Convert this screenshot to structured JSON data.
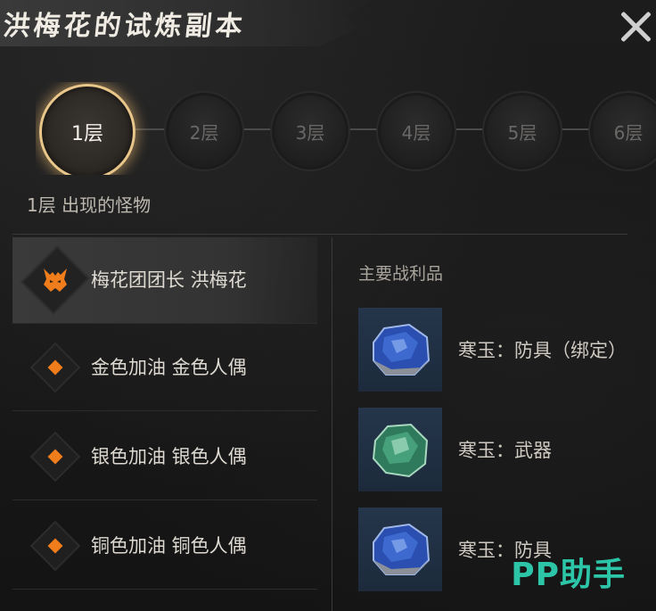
{
  "title": "洪梅花的试炼副本",
  "floors": [
    "1层",
    "2层",
    "3层",
    "4层",
    "5层",
    "6层"
  ],
  "active_floor": "1层",
  "floor_caption": "1层 出现的怪物",
  "monsters": [
    {
      "name": "梅花团团长 洪梅花",
      "icon": "boss-demon-icon"
    },
    {
      "name": "金色加油 金色人偶",
      "icon": "orange-diamond-icon"
    },
    {
      "name": "银色加油 银色人偶",
      "icon": "orange-diamond-icon"
    },
    {
      "name": "铜色加油 铜色人偶",
      "icon": "orange-diamond-icon"
    }
  ],
  "loot_title": "主要战利品",
  "loot": [
    {
      "name": "寒玉：防具（绑定）",
      "gem_color": "#2a4fb0"
    },
    {
      "name": "寒玉：武器",
      "gem_color": "#2f7a5c"
    },
    {
      "name": "寒玉：防具",
      "gem_color": "#2a4fb0"
    }
  ],
  "watermark": "PP助手",
  "colors": {
    "accent": "#f07d1c",
    "ring": "#e9c68a",
    "watermark": "#2cc5a8"
  }
}
